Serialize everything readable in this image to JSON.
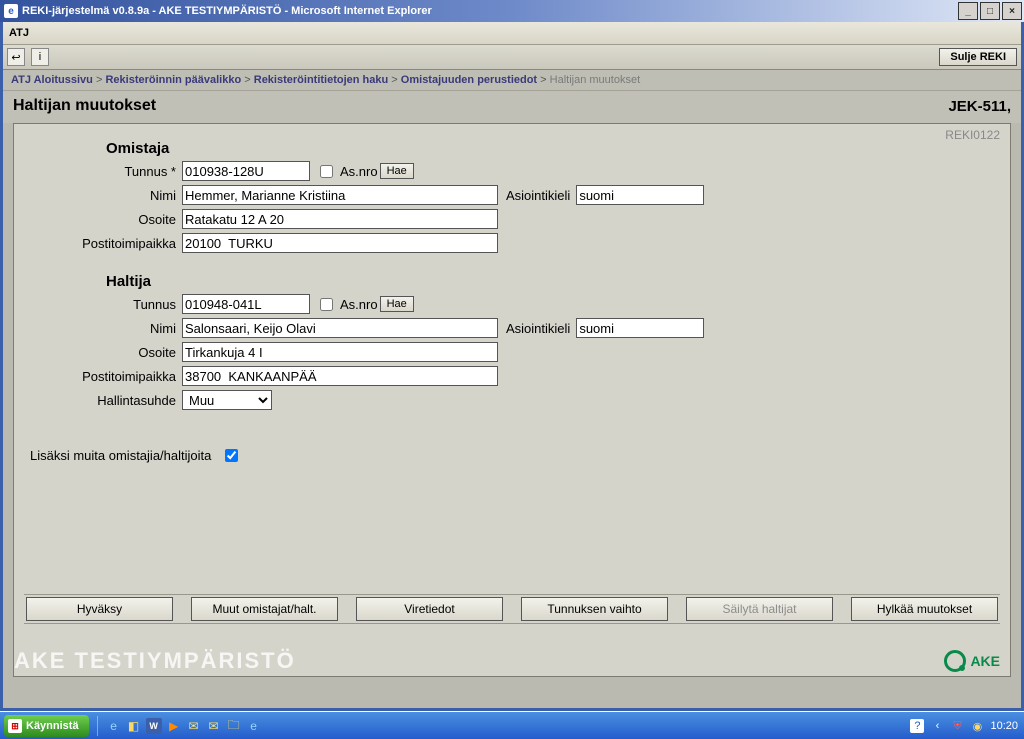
{
  "window": {
    "title": "REKI-järjestelmä v0.8.9a - AKE TESTIYMPÄRISTÖ - Microsoft Internet Explorer"
  },
  "atj_label": "ATJ",
  "iconbar": {
    "close": "Sulje REKI"
  },
  "breadcrumb": {
    "items": [
      "ATJ Aloitussivu",
      "Rekisteröinnin päävalikko",
      "Rekisteröintitietojen haku",
      "Omistajuuden perustiedot"
    ],
    "current": "Haltijan muutokset",
    "sep": ">"
  },
  "page": {
    "title": "Haltijan muutokset",
    "ref": "JEK-511,",
    "code": "REKI0122"
  },
  "labels": {
    "omistaja": "Omistaja",
    "haltija": "Haltija",
    "tunnus_req": "Tunnus *",
    "tunnus": "Tunnus",
    "asnro": "As.nro",
    "hae": "Hae",
    "nimi": "Nimi",
    "asiointikieli": "Asiointikieli",
    "osoite": "Osoite",
    "postitoimipaikka": "Postitoimipaikka",
    "hallintasuhde": "Hallintasuhde",
    "extra": "Lisäksi muita omistajia/haltijoita"
  },
  "owner": {
    "tunnus": "010938-128U",
    "asnro_checked": false,
    "nimi": "Hemmer, Marianne Kristiina",
    "kieli": "suomi",
    "osoite": "Ratakatu 12 A 20",
    "ptp": "20100  TURKU"
  },
  "holder": {
    "tunnus": "010948-041L",
    "asnro_checked": false,
    "nimi": "Salonsaari, Keijo Olavi",
    "kieli": "suomi",
    "osoite": "Tirkankuja 4 I",
    "ptp": "38700  KANKAANPÄÄ",
    "hallintasuhde": "Muu"
  },
  "extra_checked": true,
  "buttons": {
    "b1": "Hyväksy",
    "b2": "Muut omistajat/halt.",
    "b3": "Viretiedot",
    "b4": "Tunnuksen vaihto",
    "b5": "Säilytä haltijat",
    "b6": "Hylkää muutokset"
  },
  "env": "AKE TESTIYMPÄRISTÖ",
  "ake": "AKE",
  "taskbar": {
    "start": "Käynnistä",
    "clock": "10:20"
  }
}
